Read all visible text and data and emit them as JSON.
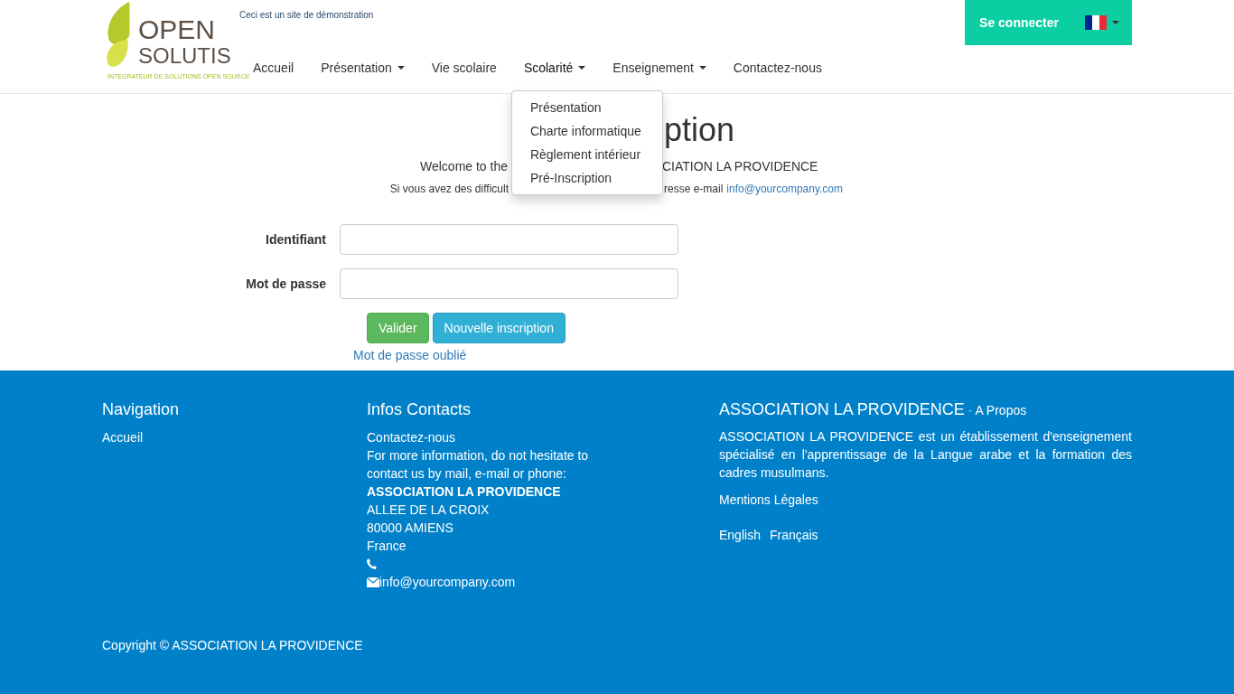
{
  "header": {
    "tagline": "Ceci est un site de démonstration",
    "logo": {
      "line1": "OPEN",
      "line2": "SOLUTIS",
      "slogan": "INTEGRATEUR DE SOLUTIONS OPEN SOURCE"
    },
    "nav": [
      {
        "label": "Accueil",
        "has_menu": false,
        "expanded": false
      },
      {
        "label": "Présentation",
        "has_menu": true,
        "expanded": false
      },
      {
        "label": "Vie scolaire",
        "has_menu": false,
        "expanded": false
      },
      {
        "label": "Scolarité",
        "has_menu": true,
        "expanded": true,
        "menu": [
          "Présentation",
          "Charte informatique",
          "Règlement intérieur",
          "Pré-Inscription"
        ]
      },
      {
        "label": "Enseignement",
        "has_menu": true,
        "expanded": false
      },
      {
        "label": "Contactez-nous",
        "has_menu": false,
        "expanded": false
      }
    ],
    "login_button": "Se connecter"
  },
  "main": {
    "title_visible": "ption",
    "welcome_left": "Welcome to the",
    "welcome_right": "CIATION LA PROVIDENCE",
    "help_left": "Si vous avez des difficult",
    "help_right": "resse e-mail",
    "help_link": "info@yourcompany.com",
    "fields": [
      {
        "label": "Identifiant"
      },
      {
        "label": "Mot de passe"
      }
    ],
    "buttons": [
      {
        "label": "Valider",
        "kind": "success"
      },
      {
        "label": "Nouvelle inscription",
        "kind": "info"
      }
    ],
    "forgot_link": "Mot de passe oublié"
  },
  "footer": {
    "nav_title": "Navigation",
    "nav_links": [
      "Accueil"
    ],
    "contact_title": "Infos Contacts",
    "contact_link": "Contactez-nous",
    "contact_text": "For more information, do not hesitate to contact us by mail, e-mail or phone:",
    "org": "ASSOCIATION LA PROVIDENCE",
    "address": [
      "ALLEE DE LA CROIX",
      "80000 AMIENS",
      "France"
    ],
    "email": "info@yourcompany.com",
    "about_title": "ASSOCIATION LA PROVIDENCE",
    "about_sep": "-",
    "about_sub": "A Propos",
    "about_text": "ASSOCIATION LA PROVIDENCE est un établissement d'enseignement spécialisé en l'apprentissage de la Langue arabe et la formation des cadres musulmans.",
    "legal": "Mentions Légales",
    "languages": [
      "English",
      "Français"
    ],
    "copyright": "Copyright © ASSOCIATION LA PROVIDENCE"
  }
}
